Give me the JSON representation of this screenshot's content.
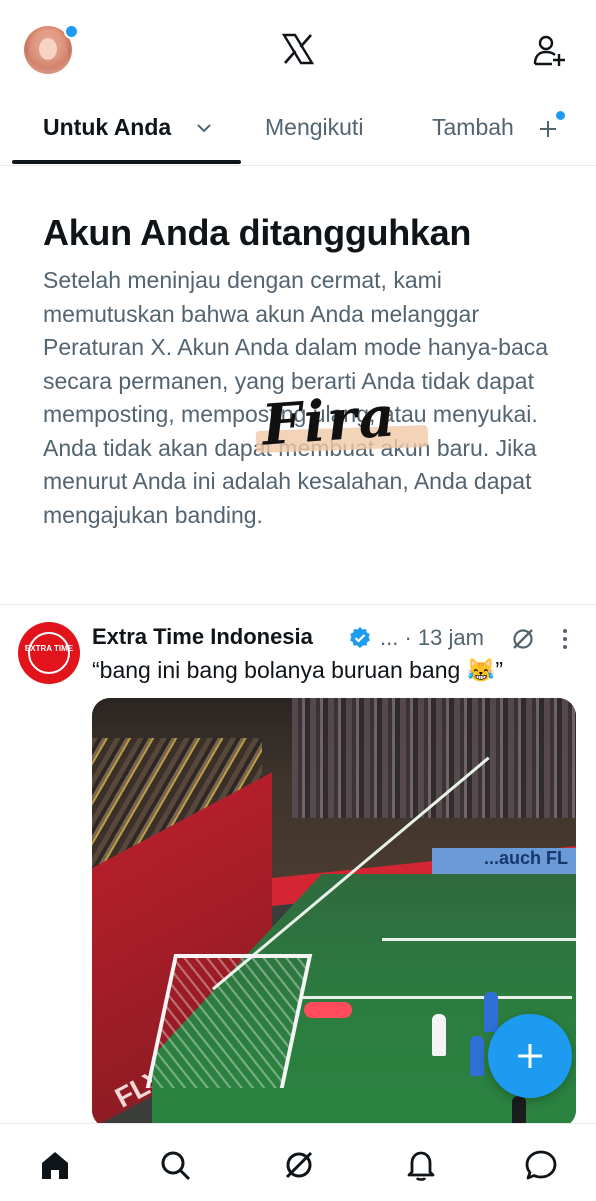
{
  "header": {
    "logo_icon": "x-logo-icon",
    "add_user_icon": "add-user-icon",
    "notification_dot_color": "#1d9bf0"
  },
  "tabs": [
    {
      "label": "Untuk Anda",
      "active": true
    },
    {
      "label": "Mengikuti",
      "active": false
    },
    {
      "label": "Tambah",
      "active": false
    }
  ],
  "notice": {
    "title": "Akun Anda ditangguhkan",
    "body": "Setelah meninjau dengan cermat, kami memutuskan bahwa akun Anda melanggar Peraturan X. Akun Anda dalam mode hanya-baca secara permanen, yang berarti Anda tidak dapat memposting, memposting ulang, atau menyukai. Anda tidak akan dapat membuat akun baru. Jika menurut Anda ini adalah kesalahan, Anda dapat mengajukan banding.",
    "watermark": "Fira"
  },
  "tweet": {
    "author": "Extra Time Indonesia",
    "avatar_text": "EXTRA TIME",
    "meta": "... · 13 jam",
    "text": "“bang ini bang bolanya buruan bang 😹”",
    "media_board_text": "...auch FL",
    "media_side_text": "FLYER ALARM"
  },
  "bottom_nav": [
    {
      "icon": "home-icon",
      "active": true
    },
    {
      "icon": "search-icon",
      "active": false
    },
    {
      "icon": "grok-icon",
      "active": false
    },
    {
      "icon": "bell-icon",
      "active": false
    },
    {
      "icon": "messages-icon",
      "active": false
    }
  ],
  "colors": {
    "accent": "#1d9bf0",
    "text_primary": "#0f1419",
    "text_secondary": "#536471"
  }
}
